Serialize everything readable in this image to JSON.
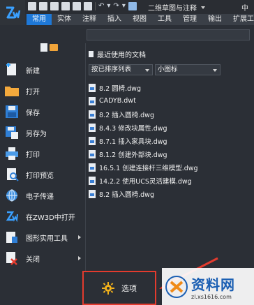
{
  "title_bar": {
    "document_title": "二维草图与注释",
    "right_text": "中"
  },
  "ribbon": {
    "tabs": [
      {
        "label": "常用",
        "active": true
      },
      {
        "label": "实体",
        "active": false
      },
      {
        "label": "注释",
        "active": false
      },
      {
        "label": "插入",
        "active": false
      },
      {
        "label": "视图",
        "active": false
      },
      {
        "label": "工具",
        "active": false
      },
      {
        "label": "管理",
        "active": false
      },
      {
        "label": "输出",
        "active": false
      },
      {
        "label": "扩展工",
        "active": false
      }
    ]
  },
  "app_menu": {
    "items": [
      {
        "label": "新建",
        "icon": "new-file-icon",
        "has_submenu": false
      },
      {
        "label": "打开",
        "icon": "open-folder-icon",
        "has_submenu": false
      },
      {
        "label": "保存",
        "icon": "save-icon",
        "has_submenu": false
      },
      {
        "label": "另存为",
        "icon": "save-as-icon",
        "has_submenu": false
      },
      {
        "label": "打印",
        "icon": "print-icon",
        "has_submenu": false
      },
      {
        "label": "打印预览",
        "icon": "print-preview-icon",
        "has_submenu": false
      },
      {
        "label": "电子传递",
        "icon": "etransmit-icon",
        "has_submenu": false
      },
      {
        "label": "在ZW3D中打开",
        "icon": "zw3d-icon",
        "has_submenu": false
      },
      {
        "label": "图形实用工具",
        "icon": "drawing-utilities-icon",
        "has_submenu": true
      },
      {
        "label": "关闭",
        "icon": "close-icon",
        "has_submenu": true
      }
    ],
    "options_label": "选项"
  },
  "recent": {
    "header": "最近使用的文档",
    "sort_by": "按已排序列表",
    "view_mode": "小图标",
    "files": [
      "8.2  圆椅.dwg",
      "CADYB.dwt",
      "8.2  插入圆椅.dwg",
      "8.4.3  修改块属性.dwg",
      "8.7.1  插入家具块.dwg",
      "8.1.2  创建外部块.dwg",
      "16.5.1  创建连接杆三维模型.dwg",
      "14.2.2  使用UCS灵活建模.dwg",
      "8.2  插入圆椅.dwg"
    ]
  },
  "watermark": {
    "main": "资料网",
    "sub": "zl.xs1616.com"
  },
  "colors": {
    "accent": "#1e78d7",
    "highlight_box": "#e33b2e",
    "menu_bg": "#2b2f36"
  }
}
